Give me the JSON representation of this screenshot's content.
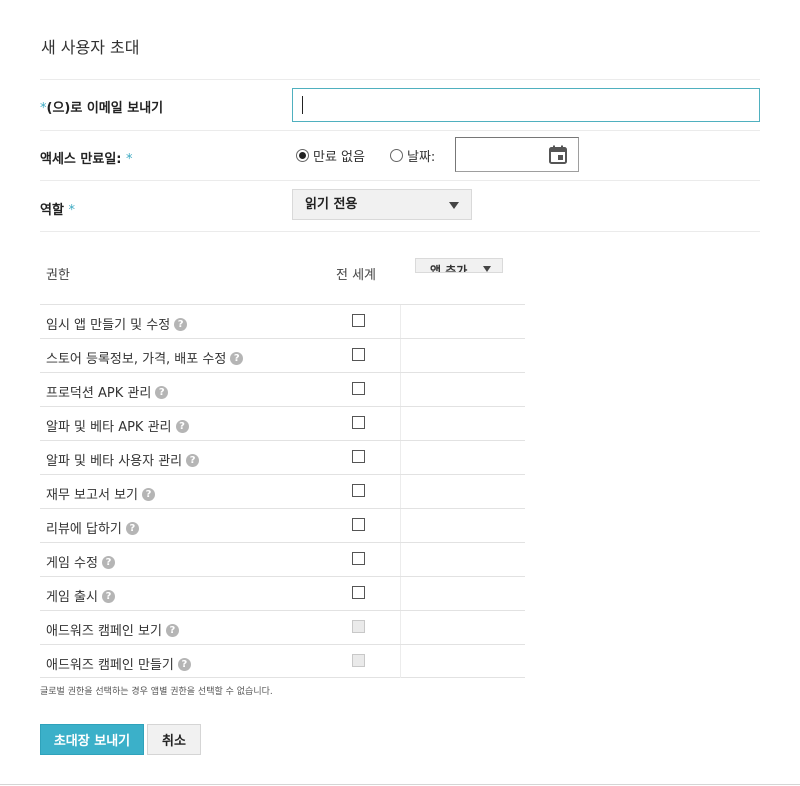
{
  "dialog": {
    "title": "새 사용자 초대"
  },
  "email": {
    "label_prefix": "*",
    "label": "(으)로 이메일 보내기",
    "value": "",
    "placeholder": ""
  },
  "access_expiry": {
    "label": "액세스 만료일:",
    "required_mark": "*",
    "option_no_expiry": "만료 없음",
    "option_date": "날짜:",
    "selected": "no_expiry",
    "date_value": ""
  },
  "role": {
    "label": "역할",
    "required_mark": "*",
    "selected": "읽기 전용"
  },
  "permissions": {
    "header_label": "권한",
    "header_global": "전 세계",
    "add_app_label": "앱 추가",
    "help_glyph": "?",
    "rows": [
      {
        "label": "임시 앱 만들기 및 수정",
        "checked": false,
        "disabled": false
      },
      {
        "label": "스토어 등록정보, 가격, 배포 수정",
        "checked": false,
        "disabled": false
      },
      {
        "label": "프로덕션 APK 관리",
        "checked": false,
        "disabled": false
      },
      {
        "label": "알파 및 베타 APK 관리",
        "checked": false,
        "disabled": false
      },
      {
        "label": "알파 및 베타 사용자 관리",
        "checked": false,
        "disabled": false
      },
      {
        "label": "재무 보고서 보기",
        "checked": false,
        "disabled": false
      },
      {
        "label": "리뷰에 답하기",
        "checked": false,
        "disabled": false
      },
      {
        "label": "게임 수정",
        "checked": false,
        "disabled": false
      },
      {
        "label": "게임 출시",
        "checked": false,
        "disabled": false
      },
      {
        "label": "애드워즈 캠페인 보기",
        "checked": false,
        "disabled": true
      },
      {
        "label": "애드워즈 캠페인 만들기",
        "checked": false,
        "disabled": true
      }
    ],
    "note": "글로벌 권한을 선택하는 경우 앱별 권한을 선택할 수 없습니다."
  },
  "actions": {
    "send_label": "초대장 보내기",
    "cancel_label": "취소"
  },
  "colors": {
    "accent": "#3bb0c9",
    "input_focus": "#4fb0bf"
  }
}
